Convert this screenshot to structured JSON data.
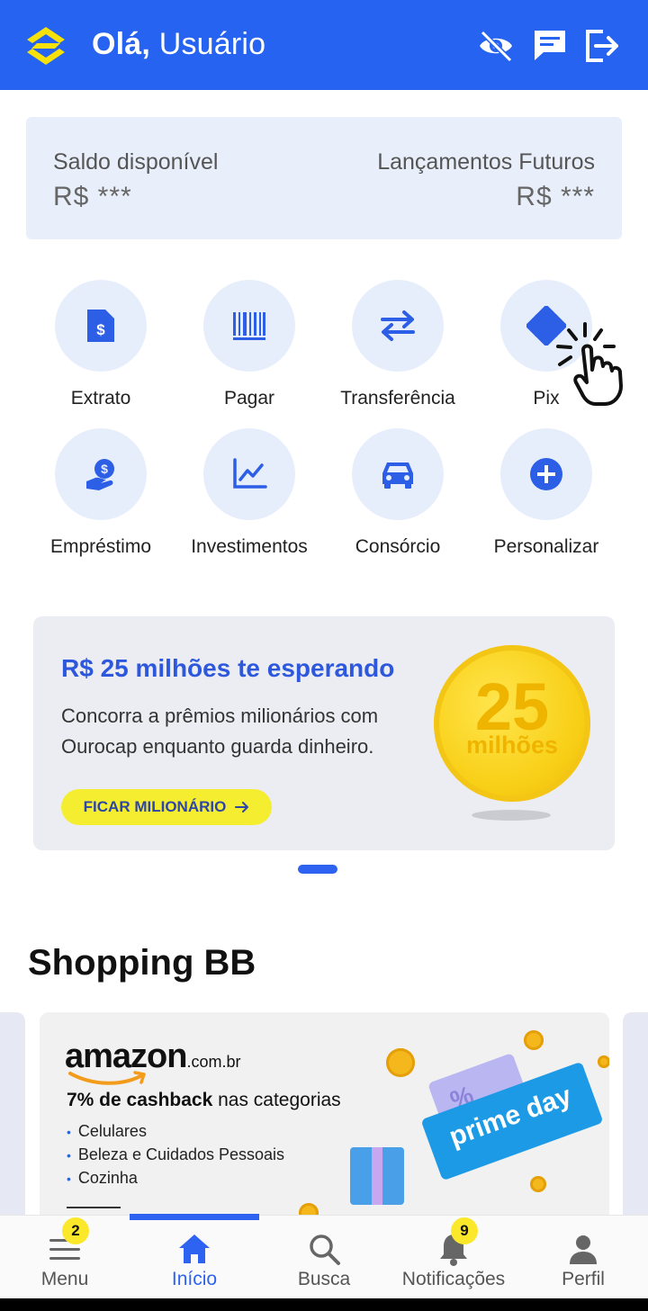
{
  "header": {
    "greeting_prefix": "Olá,",
    "greeting_name": "Usuário",
    "hide_balance_icon": "eye-off-icon",
    "chat_icon": "chat-icon",
    "logout_icon": "logout-icon",
    "bg_color": "#2563f0"
  },
  "balance": {
    "available_label": "Saldo disponível",
    "available_value": "R$ ***",
    "future_label": "Lançamentos Futuros",
    "future_value": "R$ ***"
  },
  "shortcuts": [
    {
      "label": "Extrato",
      "icon": "statement-icon"
    },
    {
      "label": "Pagar",
      "icon": "barcode-icon"
    },
    {
      "label": "Transferência",
      "icon": "transfer-icon"
    },
    {
      "label": "Pix",
      "icon": "pix-icon"
    },
    {
      "label": "Empréstimo",
      "icon": "loan-icon"
    },
    {
      "label": "Investimentos",
      "icon": "chart-icon"
    },
    {
      "label": "Consórcio",
      "icon": "car-icon"
    },
    {
      "label": "Personalizar",
      "icon": "plus-icon"
    }
  ],
  "banner": {
    "title": "R$ 25 milhões te esperando",
    "description": "Concorra a prêmios milionários com Ourocap enquanto guarda dinheiro.",
    "cta_label": "FICAR MILIONÁRIO",
    "coin_number": "25",
    "coin_text": "milhões"
  },
  "shopping": {
    "title": "Shopping BB",
    "card": {
      "brand": "amazon",
      "brand_suffix": ".com.br",
      "cashback_bold": "7% de cashback",
      "cashback_rest": " nas categorias",
      "categories": [
        "Celulares",
        "Beleza e Cuidados Pessoais",
        "Cozinha"
      ],
      "ticket_text": "prime day",
      "ticket_percent": "%"
    }
  },
  "bottom_nav": {
    "items": [
      {
        "label": "Menu",
        "icon": "menu-icon",
        "badge": "2"
      },
      {
        "label": "Início",
        "icon": "home-icon",
        "active": true
      },
      {
        "label": "Busca",
        "icon": "search-icon"
      },
      {
        "label": "Notificações",
        "icon": "bell-icon",
        "badge": "9"
      },
      {
        "label": "Perfil",
        "icon": "profile-icon"
      }
    ],
    "active_color": "#2d63f0"
  }
}
